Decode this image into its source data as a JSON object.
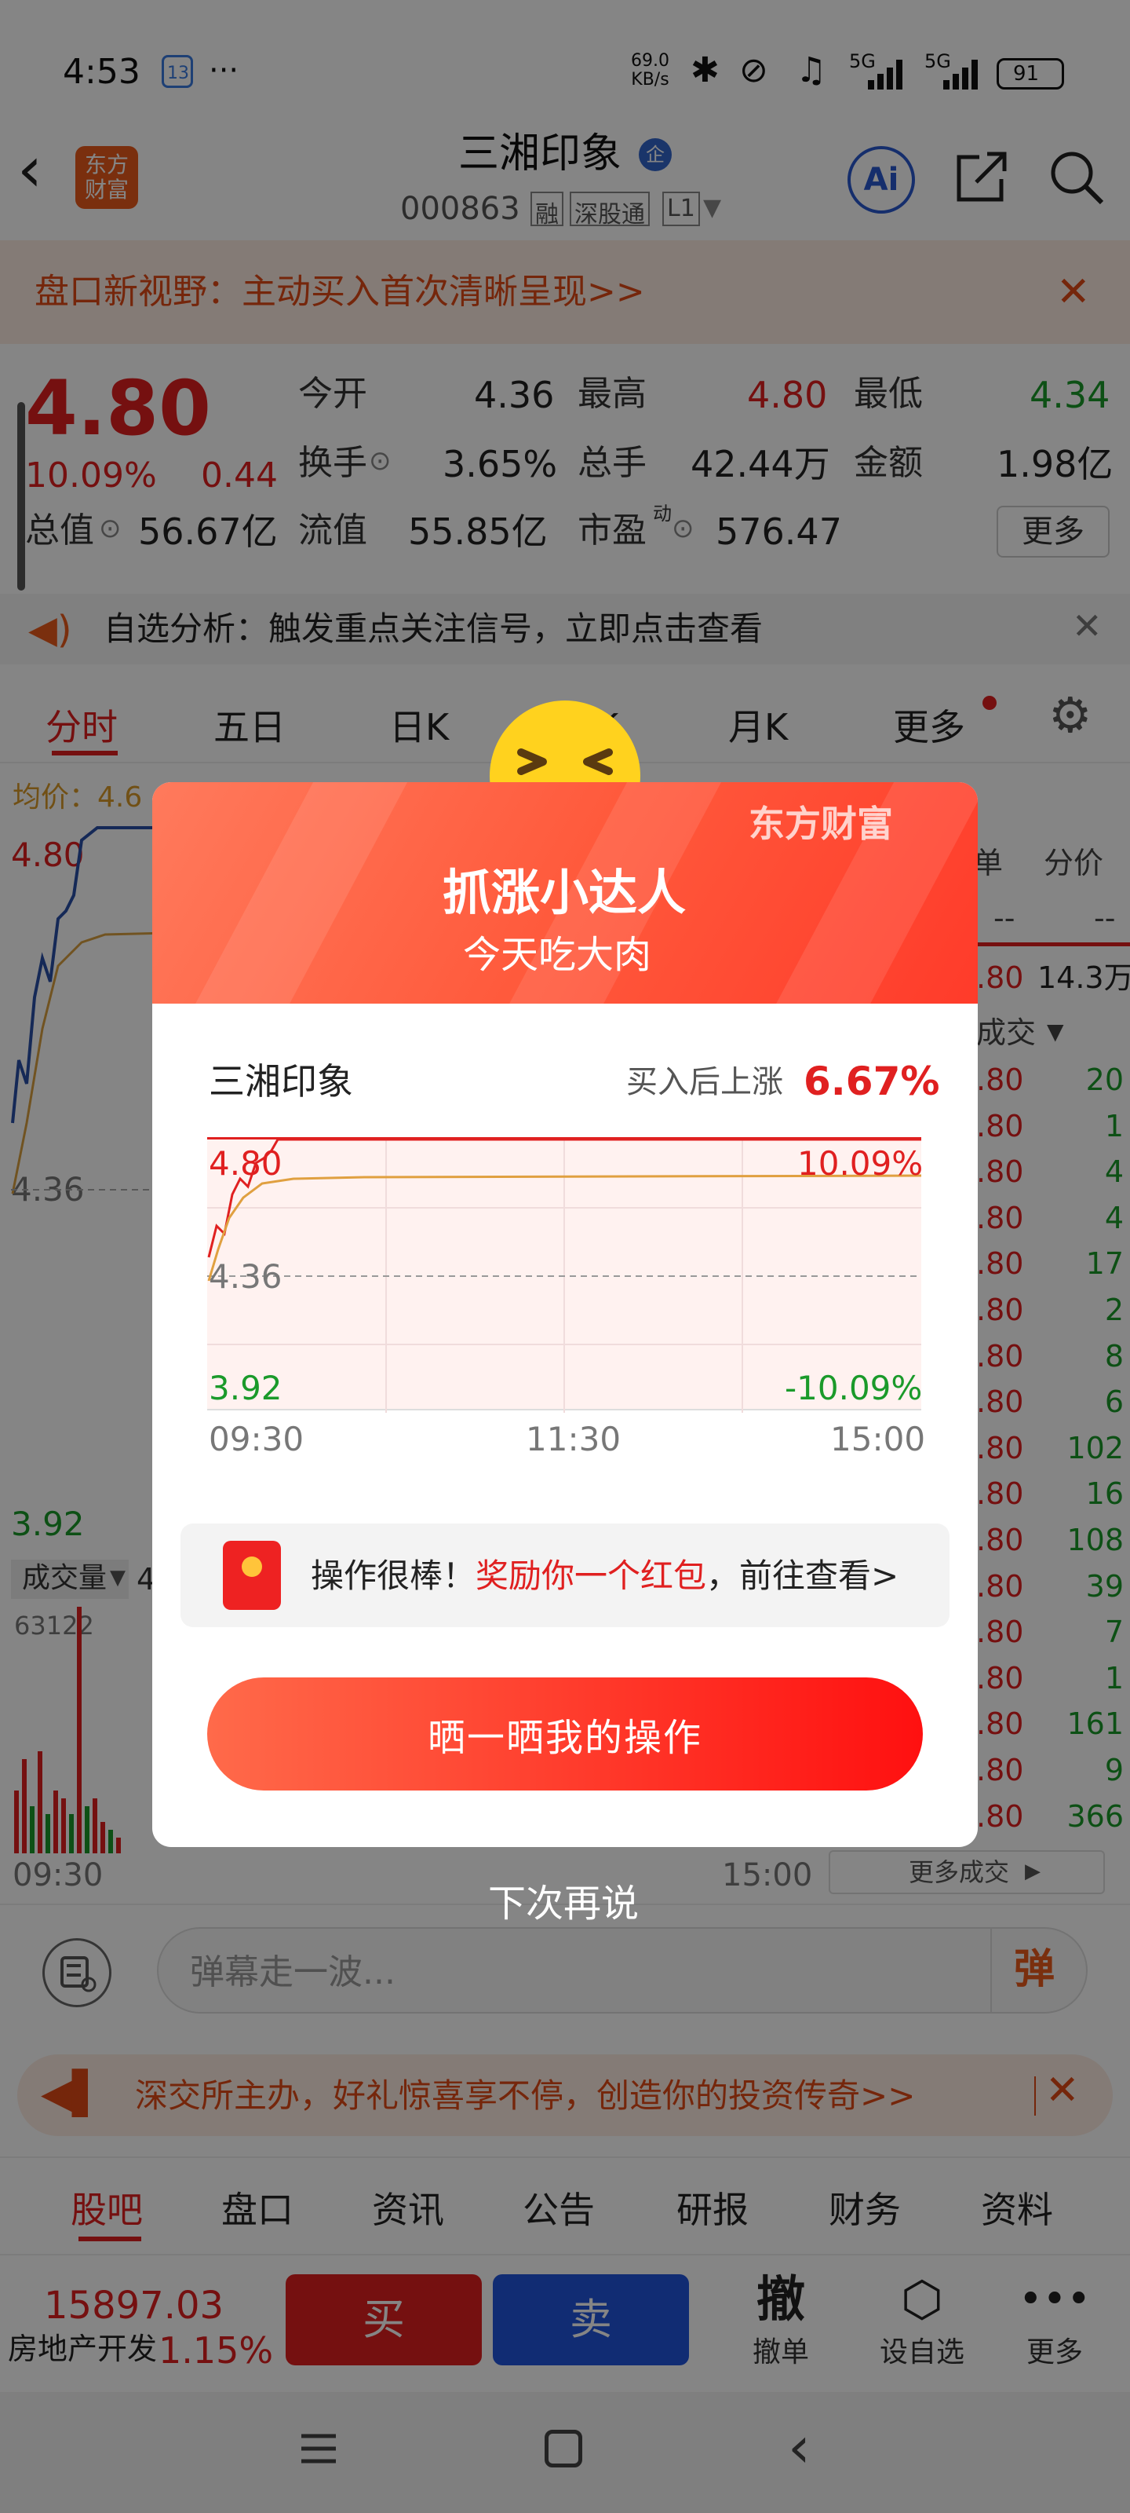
{
  "status_bar": {
    "time": "4:53",
    "calendar_day": "13",
    "dots": "···",
    "net_speed_1": "69.0",
    "net_speed_2": "KB/s",
    "sig1": "5G",
    "sig2": "5G",
    "battery": "91"
  },
  "header": {
    "logo_line1": "东方",
    "logo_line2": "财富",
    "stock_name": "三湘印象",
    "badge": "企",
    "code": "000863",
    "tag_rong": "融",
    "tag_sgt": "深股通",
    "tag_l1": "L1",
    "ai_label": "Ai"
  },
  "banner1": {
    "text": "盘口新视野：主动买入首次清晰呈现>>"
  },
  "quote": {
    "price": "4.80",
    "pct": "10.09%",
    "chg": "0.44",
    "mcap_label": "总值",
    "mcap": "56.67亿",
    "open_label": "今开",
    "open": "4.36",
    "high_label": "最高",
    "high": "4.80",
    "low_label": "最低",
    "low": "4.34",
    "turnover_label": "换手",
    "turnover": "3.65%",
    "vol_label": "总手",
    "vol": "42.44万",
    "amt_label": "金额",
    "amt": "1.98亿",
    "float_label": "流值",
    "float": "55.85亿",
    "pe_label": "市盈",
    "pe_sup": "动",
    "pe": "576.47",
    "more": "更多"
  },
  "alert": {
    "text": "自选分析：触发重点关注信号，立即点击查看"
  },
  "tabs": [
    "分时",
    "五日",
    "日K",
    "周K",
    "月K",
    "更多"
  ],
  "chart_bg": {
    "avg_label": "均价：4.6",
    "top_price": "4.80",
    "mid_price": "4.36",
    "bottom_price": "3.92",
    "vol_label": "成交量",
    "vol_val": "4",
    "vol_max": "63122",
    "time_start": "09:30",
    "time_end": "15:00",
    "col_dan": "单",
    "col_fenjia": "分价",
    "dash1": "--",
    "dash2": "--",
    "p_top": ".80",
    "p_top_vol": "14.3万",
    "chengjiao": "成交",
    "more_trades": "更多成交"
  },
  "trades": [
    {
      "p": ".80",
      "v": "20"
    },
    {
      "p": ".80",
      "v": "1"
    },
    {
      "p": ".80",
      "v": "4"
    },
    {
      "p": ".80",
      "v": "4"
    },
    {
      "p": ".80",
      "v": "17"
    },
    {
      "p": ".80",
      "v": "2"
    },
    {
      "p": ".80",
      "v": "8"
    },
    {
      "p": ".80",
      "v": "6"
    },
    {
      "p": ".80",
      "v": "102"
    },
    {
      "p": ".80",
      "v": "16"
    },
    {
      "p": ".80",
      "v": "108"
    },
    {
      "p": ".80",
      "v": "39"
    },
    {
      "p": ".80",
      "v": "7"
    },
    {
      "p": ".80",
      "v": "1"
    },
    {
      "p": ".80",
      "v": "161"
    },
    {
      "p": ".80",
      "v": "9"
    },
    {
      "p": ".80",
      "v": "366"
    }
  ],
  "danmu": {
    "placeholder": "弹幕走一波...",
    "btn": "弹"
  },
  "banner2": {
    "text": "深交所主办，好礼惊喜享不停，创造你的投资传奇>>"
  },
  "bottom_tabs": [
    "股吧",
    "盘口",
    "资讯",
    "公告",
    "研报",
    "财务",
    "资料"
  ],
  "action_bar": {
    "index_val": "15897.03",
    "index_name": "房地产开发",
    "index_pct": "1.15%",
    "buy": "买",
    "sell": "卖",
    "cancel_big": "撤",
    "cancel": "撤单",
    "set_fav": "设自选",
    "more": "更多"
  },
  "modal": {
    "brand": "东方财富",
    "title": "抓涨小达人",
    "subtitle": "今天吃大肉",
    "stock": "三湘印象",
    "gain_label": "买入后上涨",
    "gain": "6.67%",
    "chart_top_left": "4.80",
    "chart_top_right": "10.09%",
    "chart_mid": "4.36",
    "chart_bot_left": "3.92",
    "chart_bot_right": "-10.09%",
    "t1": "09:30",
    "t2": "11:30",
    "t3": "15:00",
    "reward_pre": "操作很棒！",
    "reward_red": "奖励你一个红包",
    "reward_post": "，前往查看>",
    "share_btn": "晒一晒我的操作"
  },
  "later": "下次再说",
  "colors": {
    "red": "#e02020",
    "green": "#1a9a2a",
    "brand_orange": "#ff5a3c",
    "sell_blue": "#2255dd"
  }
}
